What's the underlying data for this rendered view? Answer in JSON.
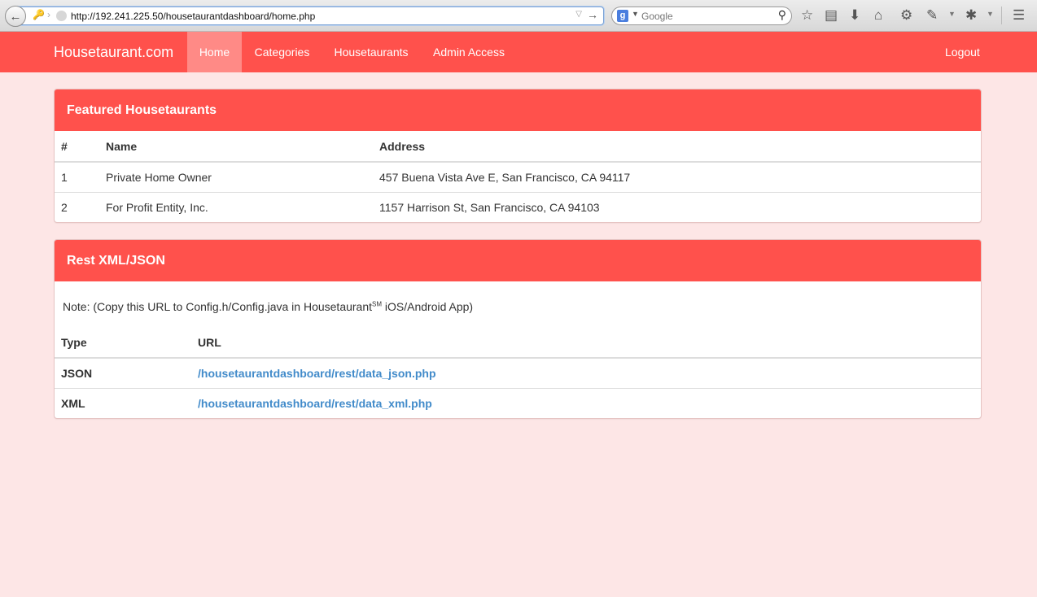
{
  "browser": {
    "url": "http://192.241.225.50/housetaurantdashboard/home.php",
    "search_placeholder": "Google",
    "search_engine_letter": "g"
  },
  "nav": {
    "brand": "Housetaurant.com",
    "items": [
      {
        "label": "Home",
        "active": true
      },
      {
        "label": "Categories",
        "active": false
      },
      {
        "label": "Housetaurants",
        "active": false
      },
      {
        "label": "Admin Access",
        "active": false
      }
    ],
    "logout": "Logout"
  },
  "featured": {
    "title": "Featured Housetaurants",
    "columns": [
      "#",
      "Name",
      "Address"
    ],
    "rows": [
      {
        "num": "1",
        "name": "Private Home Owner",
        "address": "457 Buena Vista Ave E, San Francisco, CA 94117"
      },
      {
        "num": "2",
        "name": "For Profit Entity, Inc.",
        "address": "1157 Harrison St, San Francisco, CA 94103"
      }
    ]
  },
  "rest": {
    "title": "Rest XML/JSON",
    "note_prefix": "Note: (Copy this URL to Config.h/Config.java in Housetaurant",
    "note_sup": "SM",
    "note_suffix": " iOS/Android App)",
    "columns": [
      "Type",
      "URL"
    ],
    "rows": [
      {
        "type": "JSON",
        "url": "/housetaurantdashboard/rest/data_json.php"
      },
      {
        "type": "XML",
        "url": "/housetaurantdashboard/rest/data_xml.php"
      }
    ]
  },
  "colors": {
    "navbar": "#ff514c",
    "nav_active": "#ff8a86",
    "page_bg": "#fde6e6",
    "link": "#428bca"
  }
}
